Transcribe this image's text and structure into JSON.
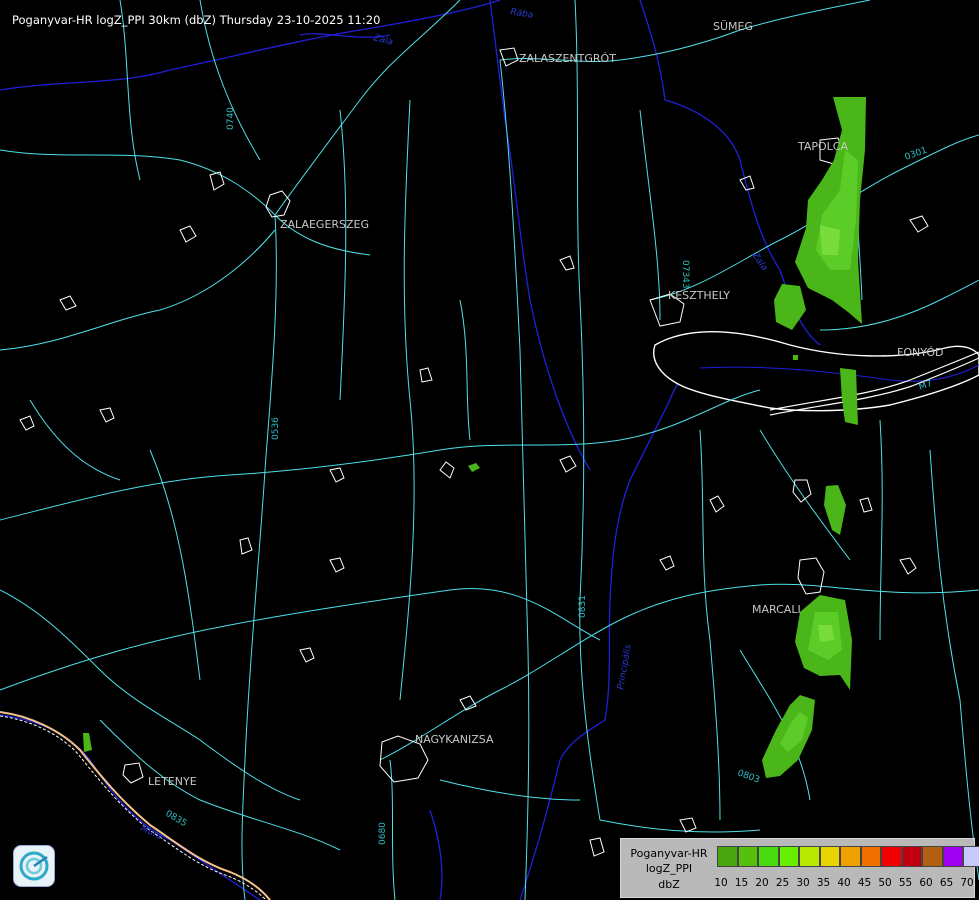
{
  "title": "Poganyvar-HR logZ_PPI 30km (dbZ) Thursday 23-10-2025 11:20",
  "cities": [
    {
      "key": "sumeg",
      "name": "SÜMEG"
    },
    {
      "key": "zalaszentgrot",
      "name": "ZALASZENTGRÓT"
    },
    {
      "key": "tapolca",
      "name": "TAPOLCA"
    },
    {
      "key": "zalaegerszeg",
      "name": "ZALAEGERSZEG"
    },
    {
      "key": "keszthely",
      "name": "KESZTHELY"
    },
    {
      "key": "fonyod",
      "name": "FONYÓD"
    },
    {
      "key": "marcali",
      "name": "MARCALI"
    },
    {
      "key": "nagykanizsa",
      "name": "NAGYKANIZSA"
    },
    {
      "key": "letenye",
      "name": "LETENYE"
    }
  ],
  "road_labels": [
    "0740",
    "07343",
    "0536",
    "0831",
    "0835",
    "0301",
    "0803",
    "M7",
    "0680"
  ],
  "river_labels": [
    "Zala",
    "Rába",
    "Principális",
    "Mura",
    "Zala"
  ],
  "legend": {
    "line1": "Poganyvar-HR",
    "line2": "logZ_PPI",
    "unit": "dbZ",
    "ticks": [
      "10",
      "15",
      "20",
      "25",
      "30",
      "35",
      "40",
      "45",
      "50",
      "55",
      "60",
      "65",
      "70"
    ],
    "colors": [
      "#4aa50e",
      "#55c00e",
      "#4ada10",
      "#66f000",
      "#b7e800",
      "#e8d400",
      "#f0a000",
      "#f07000",
      "#f00000",
      "#c00010",
      "#b06010",
      "#a000f0",
      "#c8c8ff"
    ]
  },
  "colors": {
    "background": "#000000",
    "roads": "#4fe0e8",
    "rivers": "#2020d8",
    "borders": "#ffffff",
    "echo_light": "#4ab61a",
    "echo_mid": "#5ccc28",
    "echo_strong": "#78dd3a"
  }
}
